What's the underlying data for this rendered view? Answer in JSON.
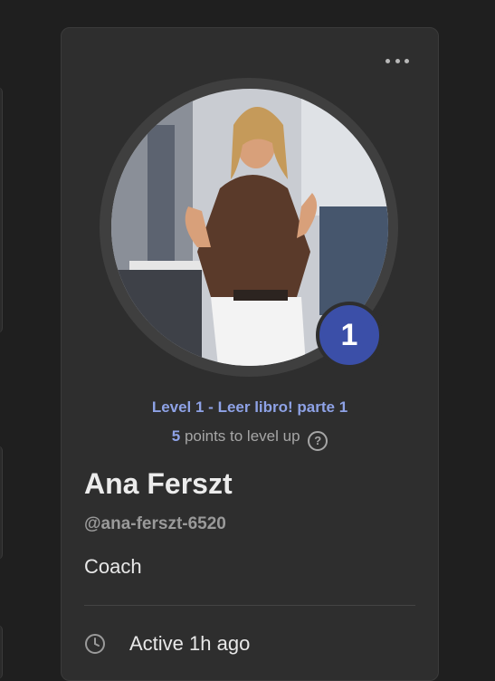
{
  "profile": {
    "level_badge": "1",
    "level_title": "Level 1 - Leer libro! parte 1",
    "points_number": "5",
    "points_text": "points to level up",
    "help_glyph": "?",
    "name": "Ana Ferszt",
    "handle": "@ana-ferszt-6520",
    "bio": "Coach",
    "activity": "Active 1h ago"
  },
  "icons": {
    "menu": "more-horizontal-icon",
    "help": "question-circle-icon",
    "activity": "clock-icon"
  },
  "colors": {
    "background": "#1f1f1f",
    "card": "#2e2e2e",
    "accent": "#8ea2e6",
    "badge": "#3b4fa8"
  }
}
